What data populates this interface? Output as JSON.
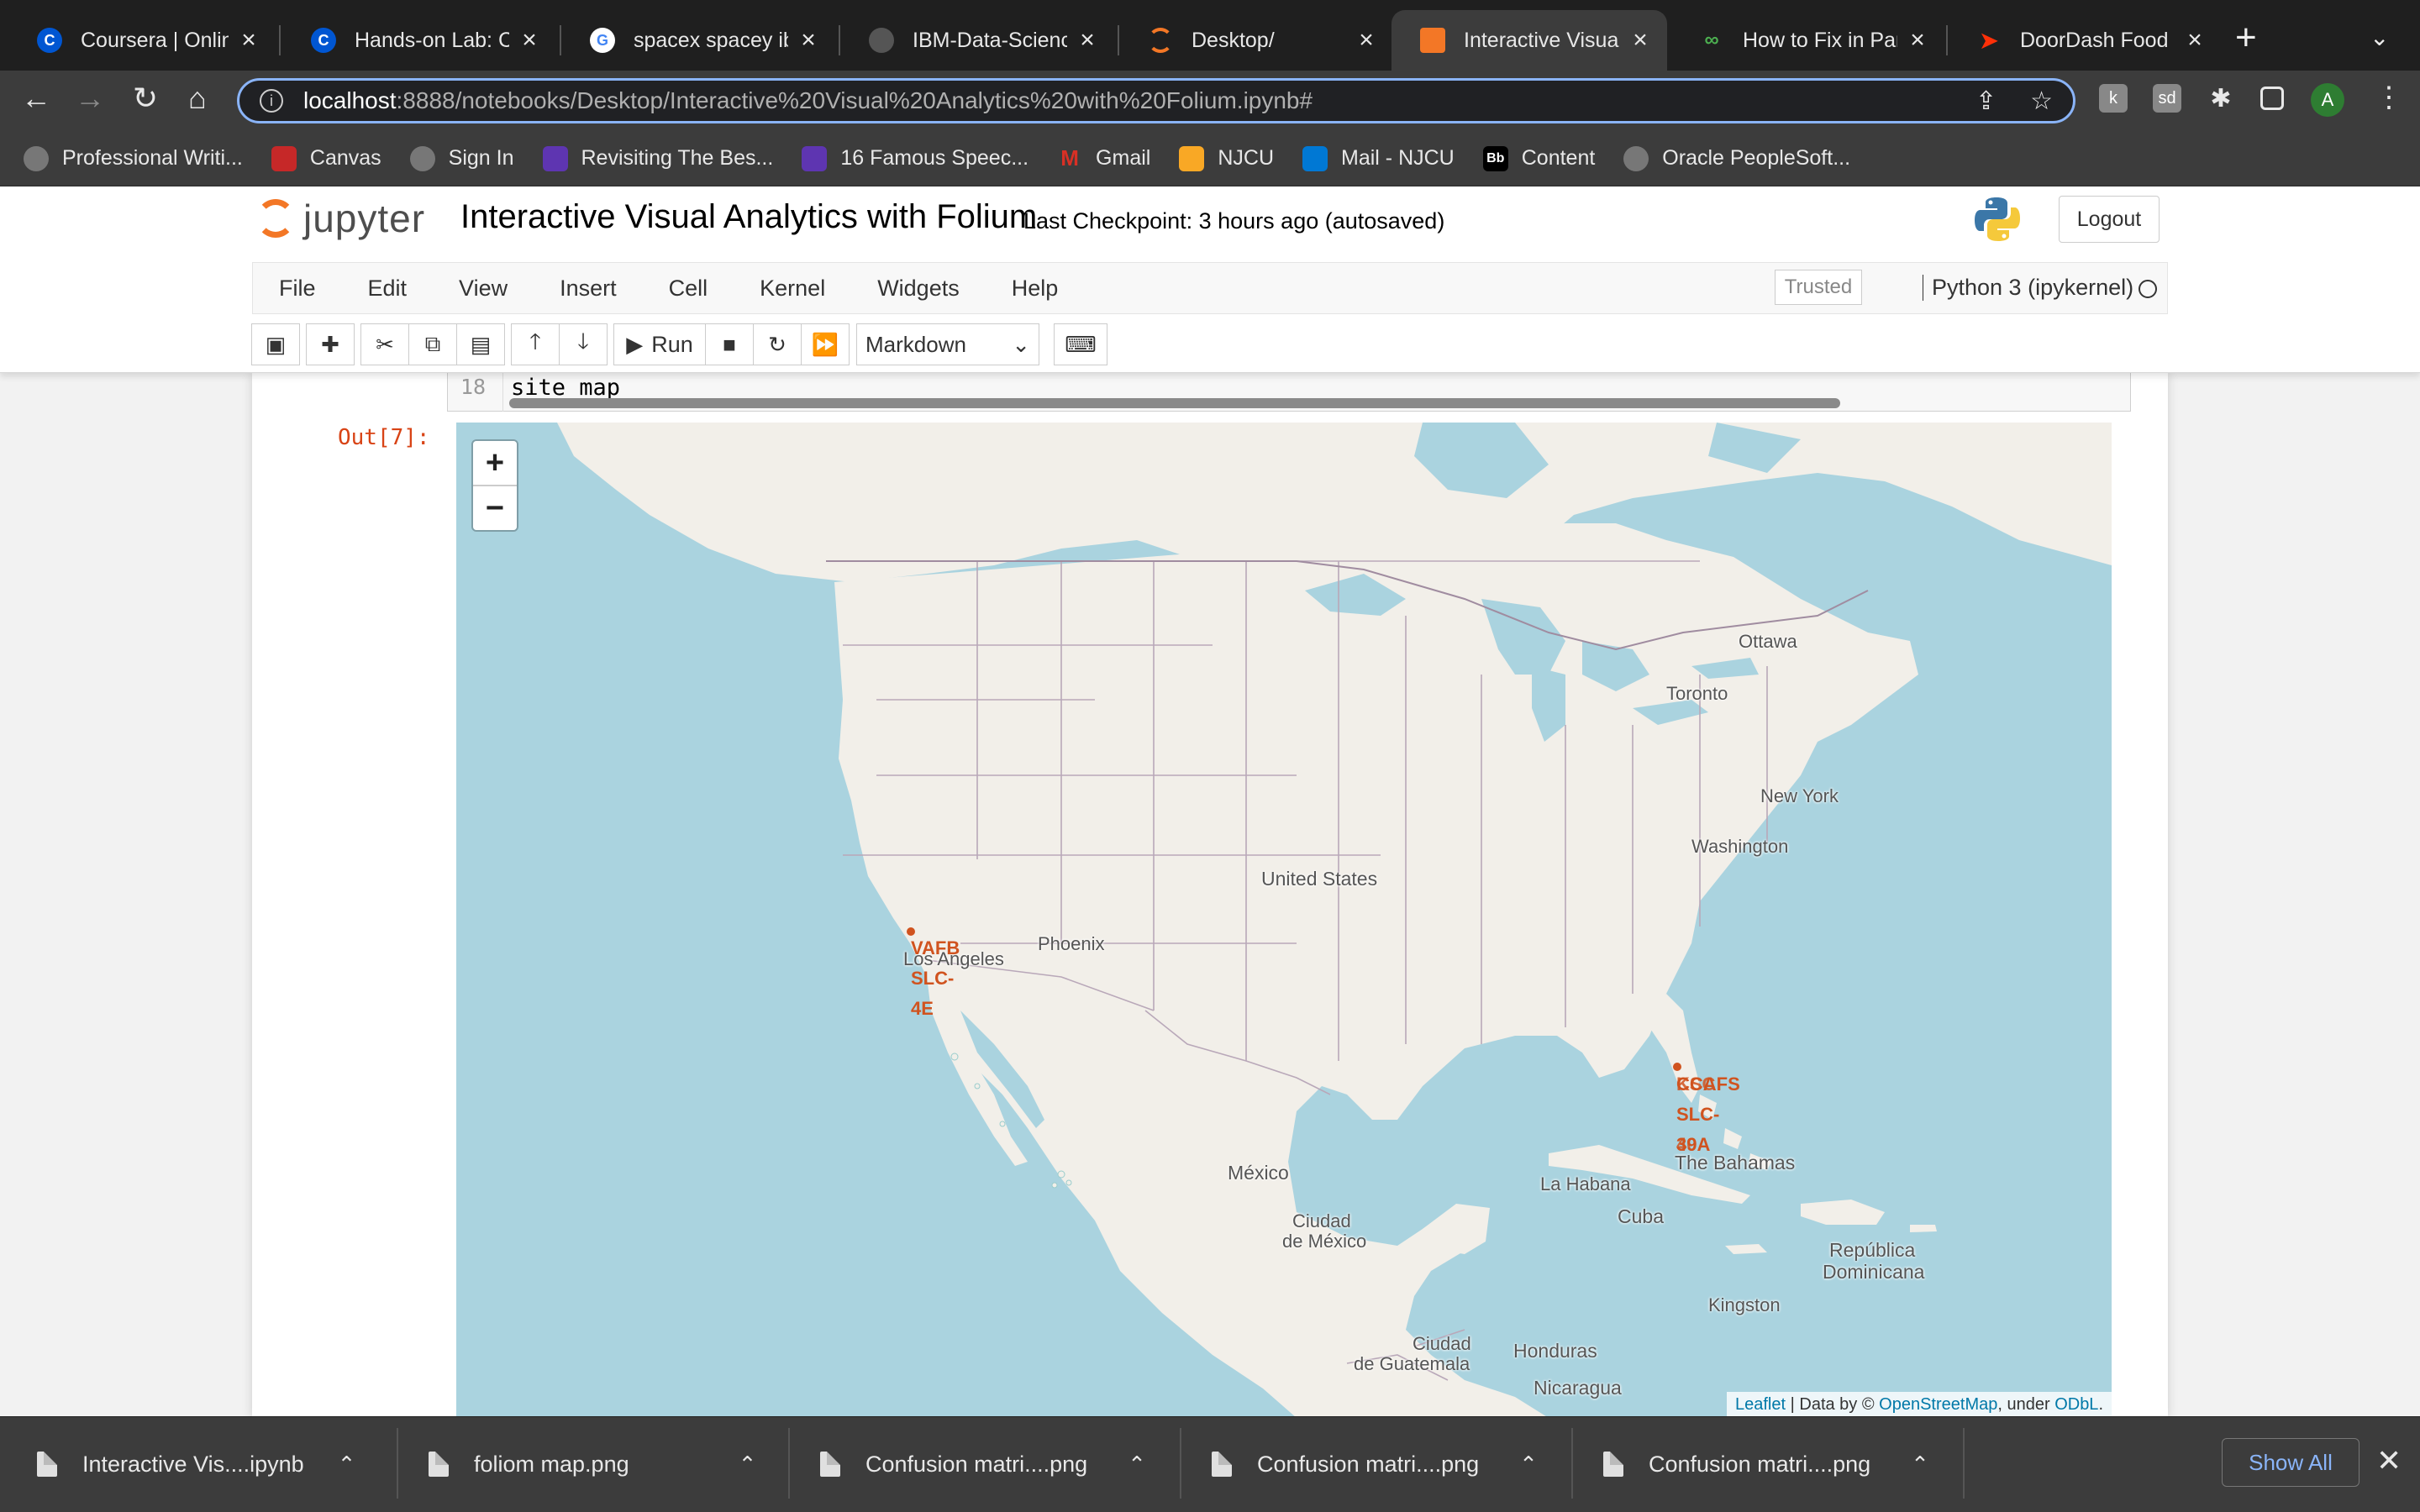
{
  "tabs": [
    {
      "title": "Coursera | Online",
      "icon": "coursera-icon",
      "color": "#0056d2",
      "letter": "C"
    },
    {
      "title": "Hands-on Lab: Co",
      "icon": "coursera-icon",
      "color": "#0056d2",
      "letter": "C"
    },
    {
      "title": "spacex spacey ibi",
      "icon": "google-icon",
      "color": "#ffffff",
      "letter": "G"
    },
    {
      "title": "IBM-Data-Science",
      "icon": "github-icon",
      "color": "#333333",
      "letter": ""
    },
    {
      "title": "Desktop/",
      "icon": "jupyter-icon",
      "color": "#f37726",
      "letter": ""
    },
    {
      "title": "Interactive Visual",
      "icon": "jupyter-notebook-icon",
      "color": "#f37726",
      "letter": "",
      "active": true
    },
    {
      "title": "How to Fix in Pan",
      "icon": "statology-icon",
      "color": "#4caf50",
      "letter": ""
    },
    {
      "title": "DoorDash Food D",
      "icon": "doordash-icon",
      "color": "#ff3008",
      "letter": ""
    }
  ],
  "address": {
    "host": "localhost",
    "path": ":8888/notebooks/Desktop/Interactive%20Visual%20Analytics%20with%20Folium.ipynb#"
  },
  "bookmarks": [
    {
      "label": "Professional Writi...",
      "icon": "globe-icon",
      "color": "#777777"
    },
    {
      "label": "Canvas",
      "icon": "canvas-icon",
      "color": "#c62828"
    },
    {
      "label": "Sign In",
      "icon": "globe-icon",
      "color": "#777777"
    },
    {
      "label": "Revisiting The Bes...",
      "icon": "swell-icon",
      "color": "#5e35b1"
    },
    {
      "label": "16 Famous Speec...",
      "icon": "swell-icon",
      "color": "#5e35b1"
    },
    {
      "label": "Gmail",
      "icon": "gmail-icon",
      "color": "#d93025"
    },
    {
      "label": "NJCU",
      "icon": "pencil-icon",
      "color": "#f9a825"
    },
    {
      "label": "Mail - NJCU",
      "icon": "outlook-icon",
      "color": "#0078d4"
    },
    {
      "label": "Content",
      "icon": "blackboard-icon",
      "color": "#000000"
    },
    {
      "label": "Oracle PeopleSoft...",
      "icon": "globe-icon",
      "color": "#777777"
    }
  ],
  "jupyter": {
    "logo_text": "jupyter",
    "title": "Interactive Visual Analytics with Folium",
    "checkpoint": "Last Checkpoint: 3 hours ago  (autosaved)",
    "logout": "Logout",
    "menu": [
      "File",
      "Edit",
      "View",
      "Insert",
      "Cell",
      "Kernel",
      "Widgets",
      "Help"
    ],
    "trusted": "Trusted",
    "kernel": "Python 3 (ipykernel)",
    "run_label": "Run",
    "cell_type": "Markdown"
  },
  "cell": {
    "line_number": "18",
    "code": "site_map",
    "out_prompt": "Out[7]:"
  },
  "map": {
    "zoom_in": "+",
    "zoom_out": "−",
    "cities": {
      "ottawa": "Ottawa",
      "toronto": "Toronto",
      "new_york": "New York",
      "washington": "Washington",
      "united_states": "United States",
      "phoenix": "Phoenix",
      "los_angeles": "Los Angeles",
      "mexico": "México",
      "ciudad_de_mexico_1": "Ciudad",
      "ciudad_de_mexico_2": "de México",
      "la_habana": "La Habana",
      "cuba": "Cuba",
      "bahamas": "The Bahamas",
      "rep_dom_1": "República",
      "rep_dom_2": "Dominicana",
      "kingston": "Kingston",
      "guatemala_1": "Ciudad",
      "guatemala_2": "de Guatemala",
      "honduras": "Honduras",
      "nicaragua": "Nicaragua"
    },
    "markers": {
      "vafb": "VAFB",
      "slc4e_1": "SLC-",
      "slc4e_2": "4E",
      "ccafs": "CCAFS",
      "ksc_1": "KSC",
      "slc_1": "SLC-",
      "slc_2": "39A",
      "slc_3": "40"
    },
    "attribution": {
      "leaflet": "Leaflet",
      "data": " | Data by © ",
      "osm": "OpenStreetMap",
      "under": ", under ",
      "odbl": "ODbL",
      "end": "."
    }
  },
  "downloads": [
    {
      "name": "Interactive Vis....ipynb"
    },
    {
      "name": "foliom map.png"
    },
    {
      "name": "Confusion matri....png"
    },
    {
      "name": "Confusion matri....png"
    },
    {
      "name": "Confusion matri....png"
    }
  ],
  "show_all": "Show All"
}
